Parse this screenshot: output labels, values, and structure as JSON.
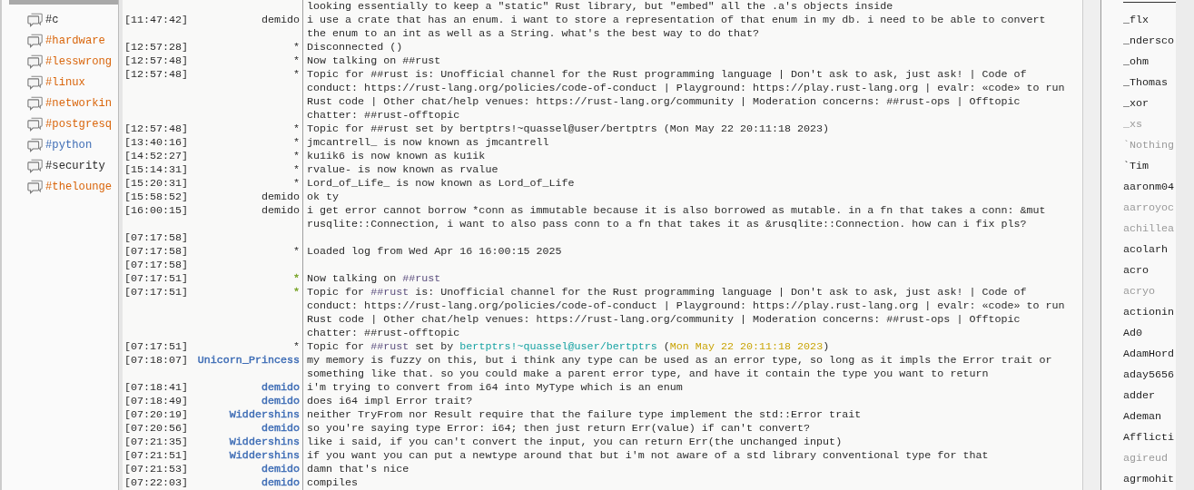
{
  "channels": [
    {
      "name": "#c"
    },
    {
      "name": "#hardware",
      "color": "#d9650b"
    },
    {
      "name": "#lesswrong",
      "color": "#d9650b"
    },
    {
      "name": "#linux",
      "color": "#d9650b"
    },
    {
      "name": "#networkin",
      "color": "#d9650b"
    },
    {
      "name": "#postgresq",
      "color": "#d9650b"
    },
    {
      "name": "#python",
      "color": "#3d6cb5"
    },
    {
      "name": "#security"
    },
    {
      "name": "#thelounge",
      "color": "#d9650b"
    }
  ],
  "messages": [
    {
      "text": "looking essentially to keep a \"static\" Rust library, but \"embed\" all the .a's objects inside"
    },
    {
      "time": "[11:47:42]",
      "nick": "demido",
      "text": "i use a crate that has an enum. i want to store a representation of that enum in my db. i need to be able to convert the enum to an int as well as a String. what's the best way to do that?"
    },
    {
      "time": "[12:57:28]",
      "nick": "*",
      "text": "Disconnected ()"
    },
    {
      "time": "[12:57:48]",
      "nick": "*",
      "text": "Now talking on ##rust"
    },
    {
      "time": "[12:57:48]",
      "nick": "*",
      "text": "Topic for ##rust is: Unofficial channel for the Rust programming language | Don't ask to ask, just ask! | Code of conduct: https://rust-lang.org/policies/code-of-conduct | Playground: https://play.rust-lang.org | evalr: «code» to run Rust code | Other chat/help venues: https://rust-lang.org/community | Moderation concerns: ##rust-ops | Offtopic chatter: ##rust-offtopic"
    },
    {
      "time": "[12:57:48]",
      "nick": "*",
      "text": "Topic for ##rust set by bertptrs!~quassel@user/bertptrs (Mon May 22 20:11:18 2023)"
    },
    {
      "time": "[13:40:16]",
      "nick": "*",
      "text": "jmcantrell_ is now known as jmcantrell"
    },
    {
      "time": "[14:52:27]",
      "nick": "*",
      "text": "ku1ik6 is now known as ku1ik"
    },
    {
      "time": "[15:14:31]",
      "nick": "*",
      "text": "rvalue- is now known as rvalue"
    },
    {
      "time": "[15:20:31]",
      "nick": "*",
      "text": "Lord_of_Life_ is now known as Lord_of_Life"
    },
    {
      "time": "[15:58:52]",
      "nick": "demido",
      "text": "ok ty"
    },
    {
      "time": "[16:00:15]",
      "nick": "demido",
      "text": "i get error cannot borrow *conn as immutable because it is also borrowed as mutable. in a fn that takes a conn: &mut rusqlite::Connection, i want to also pass conn to a fn that takes it as &rusqlite::Connection. how can i fix pls?"
    },
    {
      "time": "[07:17:58]"
    },
    {
      "time": "[07:17:58]",
      "nick": "*",
      "text": "Loaded log from Wed Apr 16 16:00:15 2025"
    },
    {
      "time": "[07:17:58]"
    },
    {
      "time": "[07:17:51]",
      "nick": "*",
      "color": "#7aa52a",
      "parts": [
        {
          "text": "Now talking on ",
          "kind": "plain"
        },
        {
          "text": "##rust",
          "kind": "channel"
        }
      ]
    },
    {
      "time": "[07:17:51]",
      "nick": "*",
      "color": "#7aa52a",
      "parts": [
        {
          "text": "Topic for ",
          "kind": "plain"
        },
        {
          "text": "##rust",
          "kind": "channel"
        },
        {
          "text": " is: Unofficial channel for the Rust programming language | Don't ask to ask, just ask! | Code of conduct: https://rust-lang.org/policies/code-of-conduct | Playground: https://play.rust-lang.org | evalr: «code» to run Rust code | Other chat/help venues: https://rust-lang.org/community | Moderation concerns: ##rust-ops | Offtopic chatter: ##rust-offtopic",
          "kind": "plain"
        }
      ]
    },
    {
      "time": "[07:17:51]",
      "nick": "*",
      "parts": [
        {
          "text": "Topic for ",
          "kind": "plain"
        },
        {
          "text": "##rust",
          "kind": "channel"
        },
        {
          "text": " set by ",
          "kind": "plain"
        },
        {
          "text": "bertptrs!~quassel@user/bertptrs",
          "kind": "host"
        },
        {
          "text": " (",
          "kind": "plain"
        },
        {
          "text": "Mon May 22 20:11:18 2023",
          "kind": "date"
        },
        {
          "text": ")",
          "kind": "plain"
        }
      ]
    },
    {
      "time": "[07:18:07]",
      "nick": "Unicorn_Princess",
      "color": "#3d6cb5",
      "text": "my memory is fuzzy on this, but i think any type can be used as an error type, so long as it impls the Error trait or something like that. so you could make a parent error type, and have it contain the type you want to return"
    },
    {
      "time": "[07:18:41]",
      "nick": "demido",
      "color": "#3d6cb5",
      "text": "i'm trying to convert from i64 into MyType which is an enum"
    },
    {
      "time": "[07:18:49]",
      "nick": "demido",
      "color": "#3d6cb5",
      "text": "does i64 impl Error trait?"
    },
    {
      "time": "[07:20:19]",
      "nick": "Widdershins",
      "color": "#3d6cb5",
      "text": "neither TryFrom nor Result require that the failure type implement the std::Error trait"
    },
    {
      "time": "[07:20:56]",
      "nick": "demido",
      "color": "#3d6cb5",
      "text": "so you're saying type Error: i64; then just return Err(value) if can't convert?"
    },
    {
      "time": "[07:21:35]",
      "nick": "Widdershins",
      "color": "#3d6cb5",
      "text": "like i said, if you can't convert the input, you can return Err(the unchanged input)"
    },
    {
      "time": "[07:21:51]",
      "nick": "Widdershins",
      "color": "#3d6cb5",
      "text": "if you want you can put a newtype around that but i'm not aware of a std library conventional type for that"
    },
    {
      "time": "[07:21:53]",
      "nick": "demido",
      "color": "#3d6cb5",
      "text": "damn that's nice"
    },
    {
      "time": "[07:22:03]",
      "nick": "demido",
      "color": "#3d6cb5",
      "text": "compiles"
    }
  ],
  "users": [
    {
      "name": "_flx",
      "away": false
    },
    {
      "name": "_ndersco",
      "away": false
    },
    {
      "name": "_ohm",
      "away": false
    },
    {
      "name": "_Thomas",
      "away": false
    },
    {
      "name": "_xor",
      "away": false
    },
    {
      "name": "_xs",
      "away": true
    },
    {
      "name": "`Nothing",
      "away": true
    },
    {
      "name": "`Tim",
      "away": false
    },
    {
      "name": "aaronm04",
      "away": false
    },
    {
      "name": "aarroyoc",
      "away": true
    },
    {
      "name": "achillea",
      "away": true
    },
    {
      "name": "acolarh",
      "away": false
    },
    {
      "name": "acro",
      "away": false
    },
    {
      "name": "acryo",
      "away": true
    },
    {
      "name": "actionin",
      "away": false
    },
    {
      "name": "Ad0",
      "away": false
    },
    {
      "name": "AdamHord",
      "away": false
    },
    {
      "name": "aday5656",
      "away": false
    },
    {
      "name": "adder",
      "away": false
    },
    {
      "name": "Ademan",
      "away": false
    },
    {
      "name": "Afflicti",
      "away": false
    },
    {
      "name": "agireud",
      "away": true
    },
    {
      "name": "agrmohit",
      "away": false
    }
  ]
}
